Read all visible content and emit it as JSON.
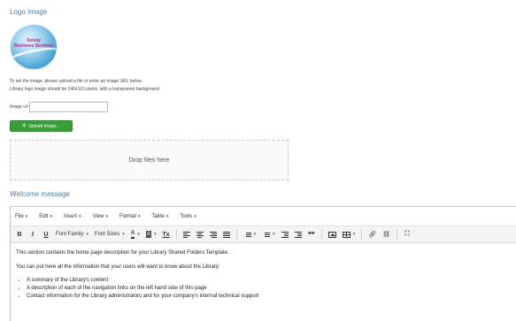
{
  "logo_section": {
    "title": "Logo Image",
    "logo_line1": "Solvay",
    "logo_line2": "Business Services",
    "help_line1": "To set the image, please upload a file or enter an image URL below.",
    "help_line2": "Library logo image should be 240x103 pixels, with a transparent background",
    "image_url_label": "Image url",
    "image_url_value": "",
    "upload_button": "Upload Image...",
    "drop_zone": "Drop files here"
  },
  "welcome_section": {
    "title": "Welcome message"
  },
  "editor": {
    "menu": [
      {
        "label": "File"
      },
      {
        "label": "Edit"
      },
      {
        "label": "Insert"
      },
      {
        "label": "View"
      },
      {
        "label": "Format"
      },
      {
        "label": "Table"
      },
      {
        "label": "Tools"
      }
    ],
    "toolbar": {
      "bold": "B",
      "italic": "I",
      "underline": "U",
      "font_family": "Font Family",
      "font_sizes": "Font Sizes",
      "text_color": "A",
      "bg_color": "A",
      "clear_format": "Tx",
      "blockquote": "❝❝",
      "icons": [
        "align-left-icon",
        "align-center-icon",
        "align-right-icon",
        "align-justify-icon",
        "bullet-list-icon",
        "numbered-list-icon",
        "outdent-icon",
        "indent-icon",
        "blockquote-icon",
        "image-icon",
        "table-icon",
        "link-icon",
        "unlink-icon",
        "fullscreen-icon"
      ]
    },
    "content": {
      "para1": "This section contains the home page description for your Library Shared Folders Template.",
      "para2": "You can put here all the information that your users will want to know about the Library:",
      "bullets": [
        "A summary of the Library's content",
        "A description of each of the navigation links on the left hand side of this page",
        "Contact information for the Library administrators and for your company's internal technical support"
      ]
    }
  }
}
